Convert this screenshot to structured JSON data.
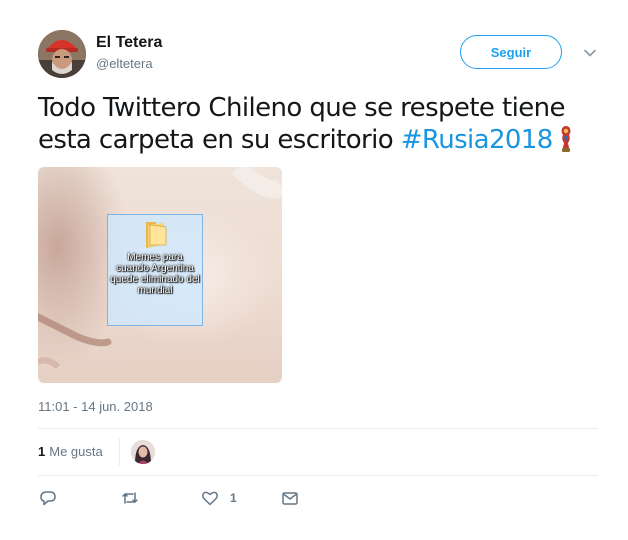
{
  "tweet": {
    "author": {
      "display_name": "El Tetera",
      "handle": "@eltetera",
      "avatar_icon": "user-avatar"
    },
    "follow_label": "Seguir",
    "text_main": "Todo Twittero Chileno que se respete tiene esta carpeta en su escritorio ",
    "hashtag": "#Rusia2018",
    "trailing_emoji": "trophy-emoji",
    "media": {
      "folder_label": "Memes para cuando Argentina quede eliminado del mundial",
      "folder_icon": "folder-icon"
    },
    "timestamp": "11:01 - 14 jun. 2018",
    "stats": {
      "likes_count": "1",
      "likes_label": "Me gusta"
    },
    "actions": {
      "reply_icon": "reply-icon",
      "retweet_icon": "retweet-icon",
      "like_icon": "heart-icon",
      "like_count": "1",
      "message_icon": "envelope-icon"
    }
  },
  "colors": {
    "accent": "#1da1f2",
    "hashtag": "#1b95e0",
    "muted": "#657786",
    "text": "#14171a",
    "divider": "#e6ecf0"
  }
}
